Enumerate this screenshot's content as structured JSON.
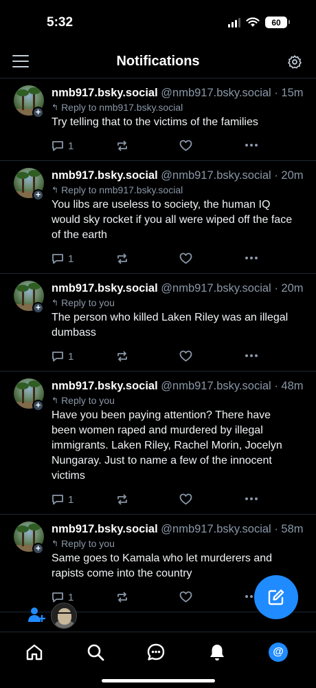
{
  "status": {
    "time": "5:32",
    "battery": "60"
  },
  "header": {
    "title": "Notifications"
  },
  "notifications": [
    {
      "name": "nmb917.bsky.social",
      "handle": "@nmb917.bsky.social",
      "time": "· 15m",
      "reply_to": "Reply to nmb917.bsky.social",
      "text": "Try telling that to the victims of the families",
      "reply_count": "1"
    },
    {
      "name": "nmb917.bsky.social",
      "handle": "@nmb917.bsky.social",
      "time": "· 20m",
      "reply_to": "Reply to nmb917.bsky.social",
      "text": "You libs are useless to society, the human IQ would sky rocket if you all were wiped off the face of the earth",
      "reply_count": "1"
    },
    {
      "name": "nmb917.bsky.social",
      "handle": "@nmb917.bsky.social",
      "time": "· 20m",
      "reply_to": "Reply to you",
      "text": "The person who killed Laken Riley was an illegal dumbass",
      "reply_count": "1"
    },
    {
      "name": "nmb917.bsky.social",
      "handle": "@nmb917.bsky.social",
      "time": "· 48m",
      "reply_to": "Reply to you",
      "text": "Have you been paying attention? There have been women raped and murdered by illegal immigrants. Laken Riley, Rachel Morin, Jocelyn Nungaray. Just to name a few of the innocent victims",
      "reply_count": "1"
    },
    {
      "name": "nmb917.bsky.social",
      "handle": "@nmb917.bsky.social",
      "time": "· 58m",
      "reply_to": "Reply to you",
      "text": "Same goes to Kamala who let murderers and rapists come into the country",
      "reply_count": "1"
    }
  ],
  "colors": {
    "accent": "#208bfe",
    "muted": "#8a98a8",
    "divider": "#1e2933"
  },
  "icons": {
    "header": [
      "menu-icon",
      "settings-gear-icon"
    ],
    "actions": [
      "reply-icon",
      "repost-icon",
      "like-icon",
      "more-icon"
    ],
    "tabs": [
      "home-icon",
      "search-icon",
      "chat-icon",
      "bell-icon",
      "at-icon"
    ],
    "fab": "compose-icon"
  }
}
